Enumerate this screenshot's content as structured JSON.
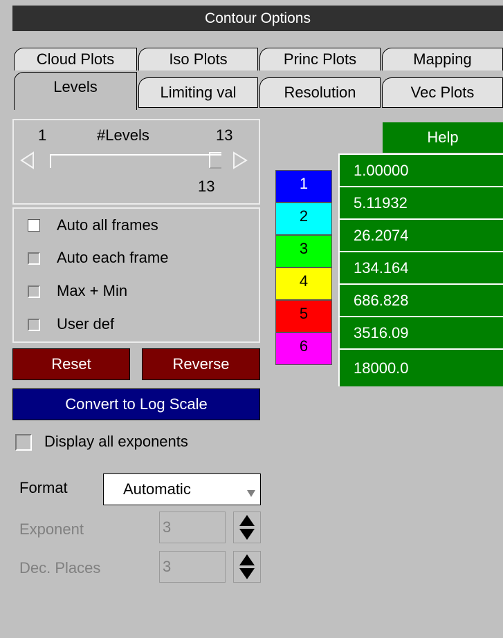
{
  "window": {
    "title": "Contour Options"
  },
  "tabs": {
    "row1": [
      "Cloud Plots",
      "Iso Plots",
      "Princ Plots",
      "Mapping"
    ],
    "row2": [
      "Levels",
      "Limiting val",
      "Resolution",
      "Vec Plots"
    ],
    "active": "Levels"
  },
  "levels_slider": {
    "min": "1",
    "label": "#Levels",
    "max": "13",
    "value": "13"
  },
  "auto_options": [
    {
      "label": "Auto all frames",
      "checked": true
    },
    {
      "label": "Auto each frame",
      "checked": false
    },
    {
      "label": "Max + Min",
      "checked": false
    },
    {
      "label": "User def",
      "checked": false
    }
  ],
  "buttons": {
    "reset": "Reset",
    "reverse": "Reverse",
    "convert_log": "Convert to Log Scale",
    "help": "Help"
  },
  "display_exponents": {
    "label": "Display all exponents",
    "checked": false
  },
  "format": {
    "label": "Format",
    "value": "Automatic"
  },
  "exponent": {
    "label": "Exponent",
    "value": "3"
  },
  "dec_places": {
    "label": "Dec. Places",
    "value": "3"
  },
  "bands": [
    {
      "label": "1",
      "color": "#0000ff",
      "text_color": "#ffffff"
    },
    {
      "label": "2",
      "color": "#00ffff",
      "text_color": "#000000"
    },
    {
      "label": "3",
      "color": "#00ff00",
      "text_color": "#000000"
    },
    {
      "label": "4",
      "color": "#ffff00",
      "text_color": "#000000"
    },
    {
      "label": "5",
      "color": "#ff0000",
      "text_color": "#000000"
    },
    {
      "label": "6",
      "color": "#ff00ff",
      "text_color": "#000000"
    }
  ],
  "level_values": [
    "1.00000",
    "5.11932",
    "26.2074",
    "134.164",
    "686.828",
    "3516.09",
    "18000.0"
  ],
  "colors": {
    "panel": "#c0c0c0",
    "title_bar": "#303030",
    "value_green": "#008000",
    "button_red": "#7a0000",
    "button_blue": "#000080"
  }
}
